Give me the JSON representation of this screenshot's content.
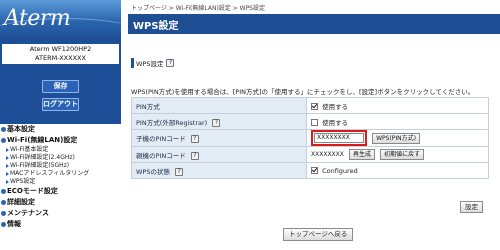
{
  "brand": {
    "logo_text": "Aterm"
  },
  "device": {
    "model": "Aterm WF1200HP2",
    "ssid": "ATERM-XXXXXX"
  },
  "sidebar_buttons": {
    "save": "保存",
    "logout": "ログアウト"
  },
  "menu": {
    "basic": "基本設定",
    "wifi": "Wi-Fi(無線LAN)設定",
    "wifi_sub": [
      "Wi-Fi基本設定",
      "Wi-Fi詳細設定(2.4GHz)",
      "Wi-Fi詳細設定(5GHz)",
      "MACアドレスフィルタリング",
      "WPS設定"
    ],
    "eco": "ECOモード設定",
    "detail": "詳細設定",
    "maintenance": "メンテナンス",
    "info": "情報"
  },
  "breadcrumb": "トップページ > Wi-Fi(無線LAN)設定 > WPS設定",
  "page_title": "WPS設定",
  "section_label": "WPS設定",
  "help_glyph": "?",
  "description": "WPS(PIN方式)を使用する場合は、[PIN方式]の「使用する」にチェックをし、[設定]ボタンをクリックしてください。",
  "rows": {
    "pin_method": {
      "label": "PIN方式",
      "value": "使用する",
      "checked": true
    },
    "pin_external": {
      "label": "PIN方式(外部Registrar)",
      "value": "使用する",
      "checked": false
    },
    "child_pin": {
      "label": "子機のPINコード",
      "input_value": "XXXXXXXX",
      "button": "WPS(PIN方式)"
    },
    "parent_pin": {
      "label": "親機のPINコード",
      "value": "XXXXXXXX",
      "regen_button": "再生成",
      "reset_button": "初期値に戻す"
    },
    "wps_status": {
      "label": "WPSの状態",
      "value": "Configured",
      "checked": true
    }
  },
  "buttons": {
    "set": "設定",
    "back": "トップページへ戻る"
  },
  "colors": {
    "header_blue": "#1e4f95",
    "highlight_red": "#d81c1c",
    "label_cell": "#e3ebf5"
  }
}
